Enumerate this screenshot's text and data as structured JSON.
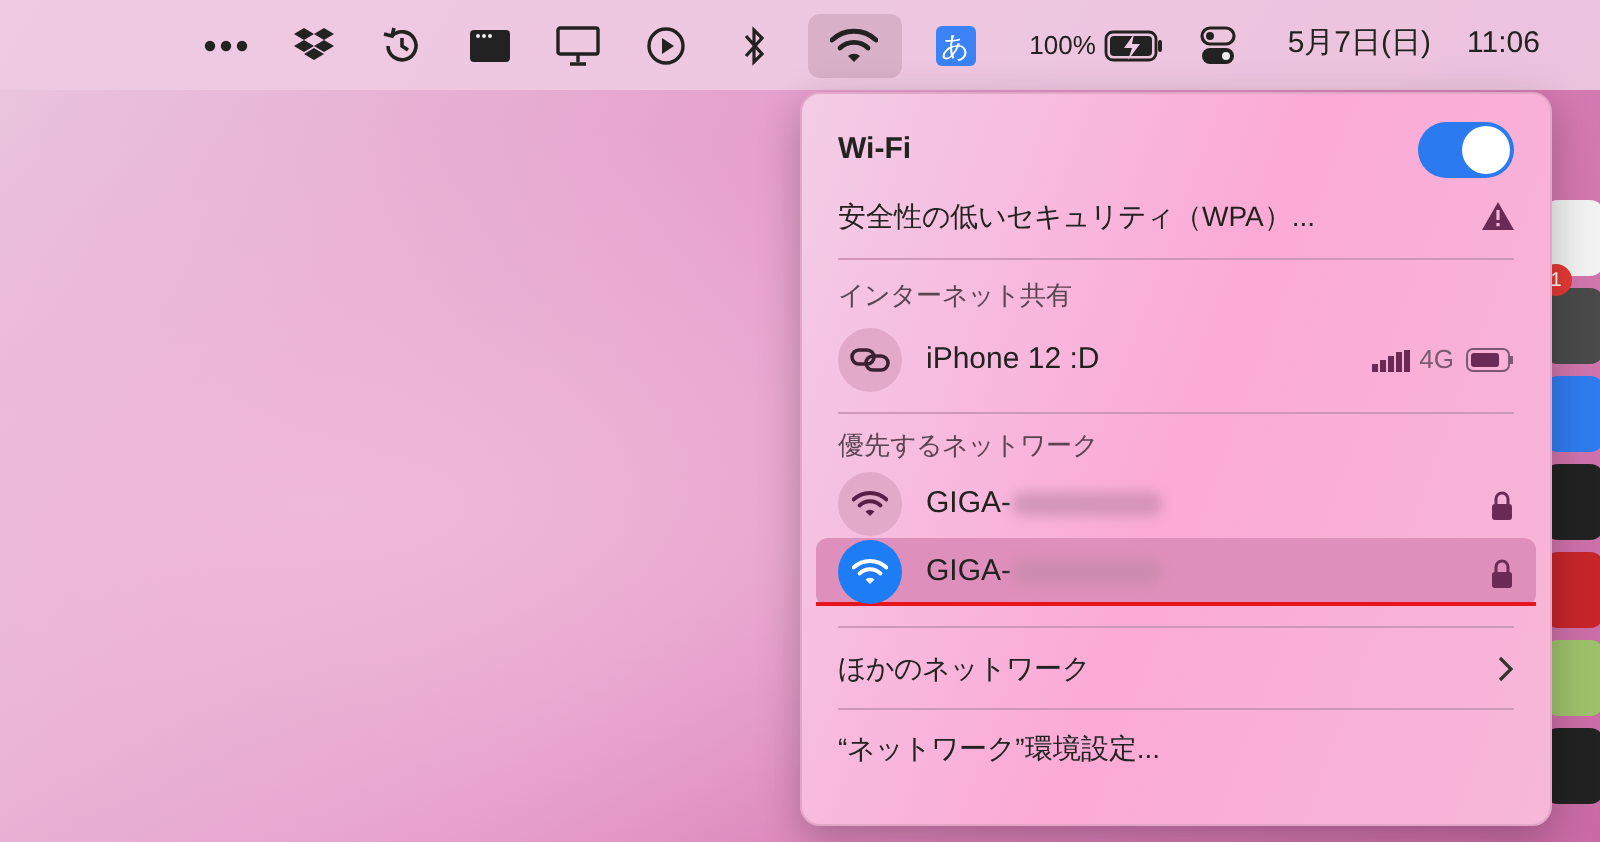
{
  "menu_bar": {
    "items": [
      {
        "kind": "dots",
        "selected": false
      },
      {
        "kind": "box",
        "selected": false
      },
      {
        "kind": "clock",
        "selected": false
      },
      {
        "kind": "window",
        "selected": false
      },
      {
        "kind": "display",
        "selected": false
      },
      {
        "kind": "play",
        "selected": false
      },
      {
        "kind": "bluetooth",
        "selected": false
      },
      {
        "kind": "wifi",
        "selected": true
      },
      {
        "kind": "input",
        "label": "あ",
        "selected": false
      },
      {
        "kind": "battery",
        "label": "100%",
        "selected": false
      },
      {
        "kind": "switches",
        "selected": false
      }
    ],
    "date": "5月7日(日)",
    "time": "11:06"
  },
  "wifi_menu": {
    "title": "Wi-Fi",
    "on": true,
    "warning": "安全性の低いセキュリティ（WPA）...",
    "hotspot_header": "インターネット共有",
    "hotspot": {
      "name": "iPhone 12 :D",
      "signal": "4G"
    },
    "preferred_header": "優先するネットワーク",
    "networks": [
      {
        "name": "GIGA-",
        "connected": false,
        "selected": false
      },
      {
        "name": "GIGA-",
        "connected": true,
        "selected": true
      }
    ],
    "other_networks": "ほかのネットワーク",
    "preferences": "“ネットワーク”環境設定..."
  },
  "dock": {
    "badge": "1"
  }
}
